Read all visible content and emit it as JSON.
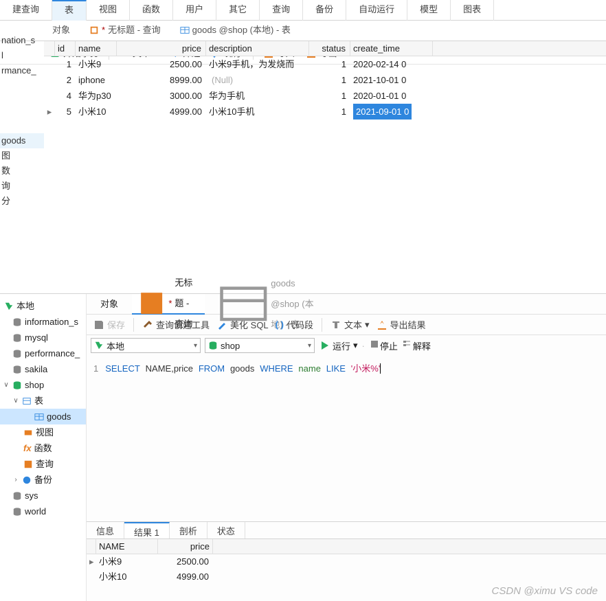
{
  "menu_tabs": {
    "new_query": "建查询",
    "table": "表",
    "view": "视图",
    "function": "函数",
    "user": "用户",
    "other": "其它",
    "query": "查询",
    "backup": "备份",
    "autorun": "自动运行",
    "model": "模型",
    "chart": "图表"
  },
  "doc_tabs": {
    "objects": "对象",
    "untitled_query": "无标题 - 查询",
    "star": "*",
    "goods_tab": "goods @shop (本地) - 表"
  },
  "top_toolbar": {
    "begin_trans": "开始事务",
    "text": "文本",
    "filter": "筛选",
    "sort": "排序",
    "import": "导入",
    "export": "导出"
  },
  "top_tree_cutoff": {
    "a": "nation_s",
    "b": "l",
    "c": "rmance_",
    "goods": "goods",
    "s1": "图",
    "s2": "数",
    "s3": "询",
    "s4": "分"
  },
  "table": {
    "headers": {
      "id": "id",
      "name": "name",
      "price": "price",
      "description": "description",
      "status": "status",
      "create_time": "create_time"
    },
    "rows": [
      {
        "ind": "",
        "id": "1",
        "name": "小米9",
        "price": "2500.00",
        "description": "小米9手机，为发烧而",
        "status": "1",
        "create_time": "2020-02-14 0",
        "sel": false
      },
      {
        "ind": "",
        "id": "2",
        "name": "iphone",
        "price": "8999.00",
        "description": "(Null)",
        "null": true,
        "status": "1",
        "create_time": "2021-10-01 0",
        "sel": false
      },
      {
        "ind": "",
        "id": "4",
        "name": "华为p30",
        "price": "3000.00",
        "description": "华为手机",
        "status": "1",
        "create_time": "2020-01-01 0",
        "sel": false
      },
      {
        "ind": "▸",
        "id": "5",
        "name": "小米10",
        "price": "4999.00",
        "description": "小米10手机",
        "status": "1",
        "create_time": "2021-09-01 0",
        "sel": true
      }
    ]
  },
  "lower_tree": {
    "local": "本地",
    "info": "information_s",
    "mysql": "mysql",
    "perf": "performance_",
    "sakila": "sakila",
    "shop": "shop",
    "shop_table_group": "表",
    "goods": "goods",
    "view": "视图",
    "func": "函数",
    "query_node": "查询",
    "backup_node": "备份",
    "sys": "sys",
    "world": "world"
  },
  "lower_doctabs": {
    "objects": "对象",
    "untitled": "无标题 - 查询",
    "star": "*",
    "goods": "goods @shop (本地) - 表"
  },
  "lower_toolbar": {
    "save": "保存",
    "query_builder": "查询创建工具",
    "beautify": "美化 SQL",
    "snippet": "代码段",
    "text": "文本",
    "export": "导出结果"
  },
  "conn_row": {
    "local": "本地",
    "shop": "shop",
    "run": "运行",
    "stop": "停止",
    "explain": "解释"
  },
  "sql": {
    "line": "1",
    "select": "SELECT",
    "name": "NAME",
    "comma": ",",
    "price": "price",
    "from": "FROM",
    "goods": "goods",
    "where": "WHERE",
    "col": "name",
    "like": "LIKE",
    "str": "'小米%'"
  },
  "result_tabs": {
    "info": "信息",
    "res1": "结果 1",
    "profile": "剖析",
    "status": "状态"
  },
  "result": {
    "headers": {
      "name": "NAME",
      "price": "price"
    },
    "rows": [
      {
        "ind": "▸",
        "name": "小米9",
        "price": "2500.00"
      },
      {
        "ind": "",
        "name": "小米10",
        "price": "4999.00"
      }
    ]
  },
  "watermark": "CSDN @ximu VS code"
}
